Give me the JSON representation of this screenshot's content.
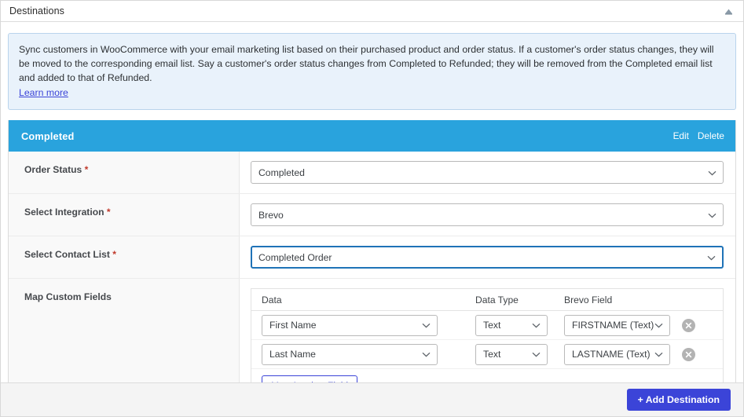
{
  "panel": {
    "title": "Destinations",
    "collapse_icon": "chevron-up-icon"
  },
  "notice": {
    "text": "Sync customers in WooCommerce with your email marketing list based on their purchased product and order status. If a customer's order status changes, they will be moved to the corresponding email list. Say a customer's order status changes from Completed to Refunded; they will be removed from the Completed email list and added to that of Refunded.",
    "link_label": "Learn more"
  },
  "destination": {
    "header_title": "Completed",
    "header_bg": "#29a3dd",
    "edit_label": "Edit",
    "delete_label": "Delete",
    "fields": [
      {
        "label": "Order Status",
        "required_marker": "*",
        "value": "Completed",
        "chevron": "chevron-down-icon",
        "focused": false
      },
      {
        "label": "Select Integration",
        "required_marker": "*",
        "value": "Brevo",
        "chevron": "chevron-down-icon",
        "focused": false
      },
      {
        "label": "Select Contact List",
        "required_marker": "*",
        "value": "Completed Order",
        "chevron": "chevron-down-icon",
        "focused": true
      }
    ],
    "map_custom_fields": {
      "label": "Map Custom Fields",
      "columns": [
        "Data",
        "Data Type",
        "Brevo Field"
      ],
      "rows": [
        {
          "data": "First Name",
          "data_type": "Text",
          "target_field": "FIRSTNAME (Text)",
          "remove_icon": "close-circle-icon"
        },
        {
          "data": "Last Name",
          "data_type": "Text",
          "target_field": "LASTNAME (Text)",
          "remove_icon": "close-circle-icon"
        }
      ],
      "add_row_label": "Map Another Field"
    }
  },
  "footer": {
    "add_destination_label": "+ Add Destination",
    "accent": "#3b44d8"
  }
}
